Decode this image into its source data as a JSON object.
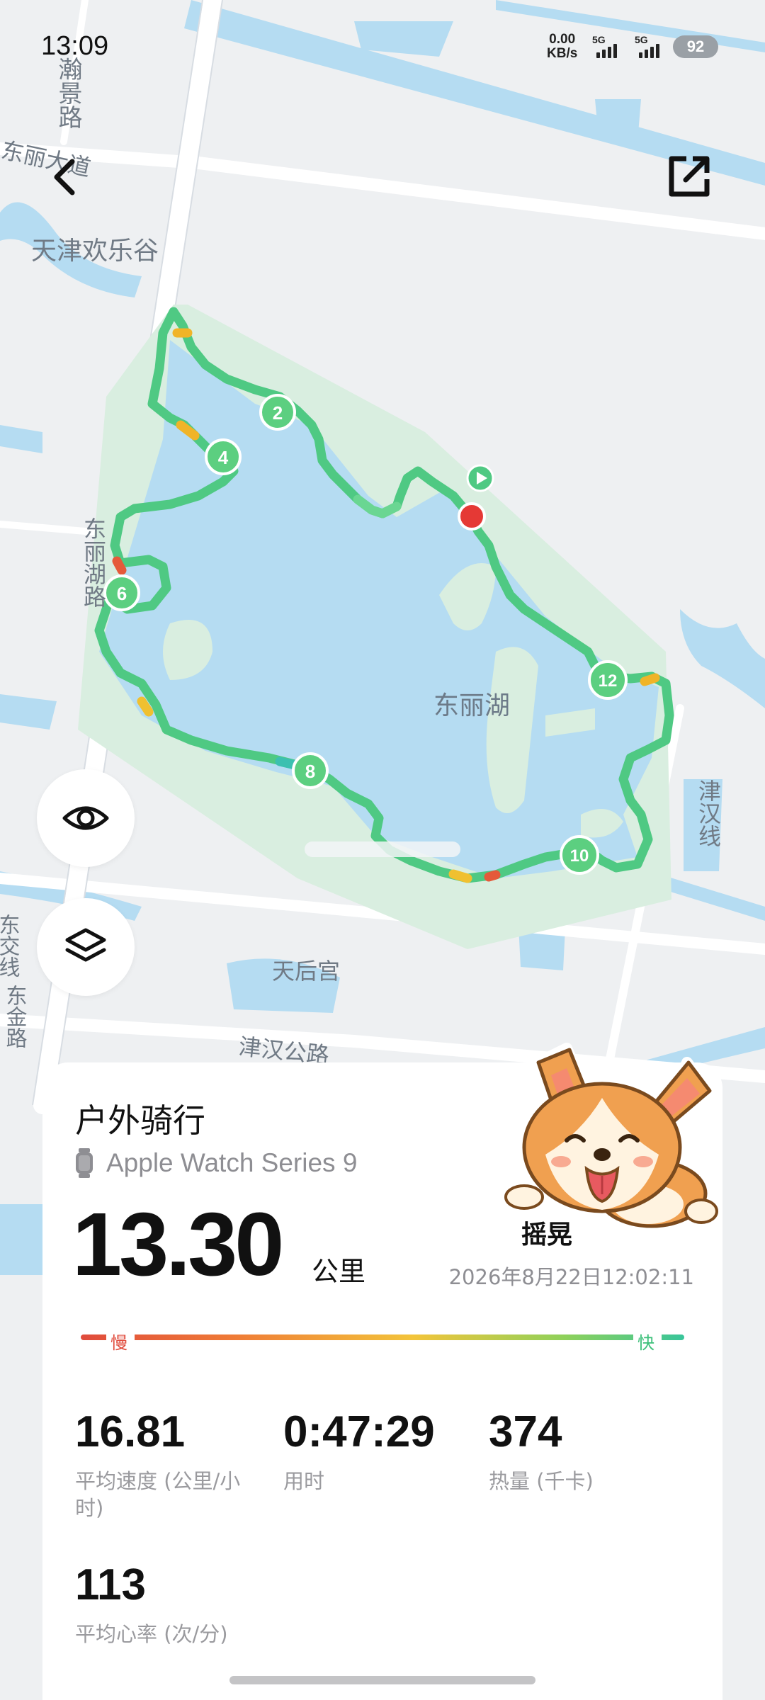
{
  "status_bar": {
    "time": "13:09",
    "net_speed_value": "0.00",
    "net_speed_unit": "KB/s",
    "sim1_label": "5G",
    "sim2_label": "5G",
    "battery": "92"
  },
  "map": {
    "labels": {
      "hanjing_road": "瀚景路",
      "dongli_avenue": "东丽大道",
      "happy_valley": "天津欢乐谷",
      "donglihu_road": "东丽湖路",
      "lake": "东丽湖",
      "jinhan_line": "津汉线",
      "tianhou_temple": "天后宫",
      "jinhan_road": "津汉公路",
      "road_left": "东交线",
      "dongjin_road": "东金路"
    },
    "km_markers": [
      "2",
      "4",
      "6",
      "8",
      "10",
      "12"
    ],
    "colors": {
      "water": "#b5dcf2",
      "park": "#d9eee0",
      "route": "#5ccf80",
      "start": "#e53935"
    }
  },
  "controls": {
    "back_icon": "chevron-left-icon",
    "share_icon": "external-link-icon",
    "visibility_icon": "eye-icon",
    "layers_icon": "layers-icon"
  },
  "summary": {
    "activity_title": "户外骑行",
    "device_name": "Apple Watch Series 9",
    "distance": "13.30",
    "distance_unit": "公里",
    "partial_text": "摇晃",
    "datetime": "2026年8月22日12:02:11",
    "speed_legend": {
      "slow": "慢",
      "fast": "快"
    },
    "stats": [
      {
        "value": "16.81",
        "label": "平均速度 (公里/小时)"
      },
      {
        "value": "0:47:29",
        "label": "用时"
      },
      {
        "value": "374",
        "label": "热量 (千卡)"
      },
      {
        "value": "113",
        "label": "平均心率 (次/分)"
      }
    ]
  },
  "mascot": {
    "name": "corgi-sticker"
  }
}
